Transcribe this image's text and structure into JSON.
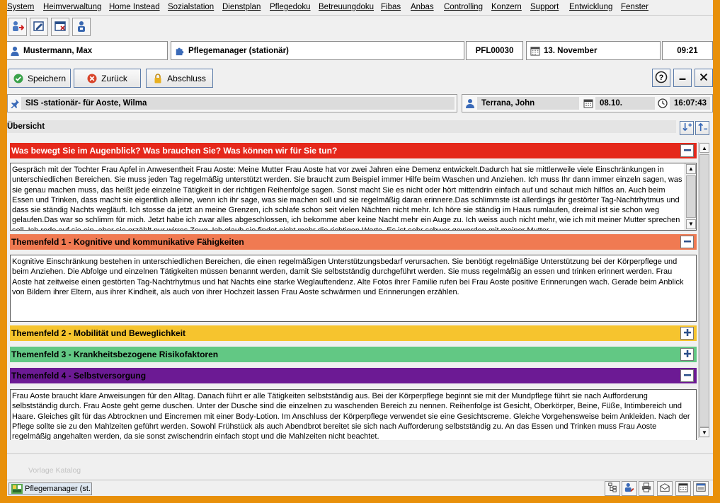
{
  "menu": [
    "System",
    "Heimverwaltung",
    "Home Instead",
    "Sozialstation",
    "Dienstplan",
    "Pflegedoku",
    "Betreuungdoku",
    "Fibas",
    "Anbas",
    "Controlling",
    "Konzern",
    "Support",
    "Entwicklung",
    "Fenster"
  ],
  "toolbar_icons": [
    "exit-icon",
    "edit-icon",
    "close-window-icon",
    "person-card-icon"
  ],
  "header": {
    "user": "Mustermann, Max",
    "module": "Pflegemanager (stationär)",
    "code": "PFL00030",
    "date": "13. November",
    "time": "09:21"
  },
  "actions": {
    "save": "Speichern",
    "back": "Zurück",
    "finish": "Abschluss"
  },
  "record": {
    "title": "SIS -stationär- für Aoste, Wilma",
    "author": "Terrana, John",
    "date": "08.10.",
    "time": "16:07:43"
  },
  "overview_label": "Übersicht",
  "sections": [
    {
      "title": "Was bewegt Sie im Augenblick? Was brauchen Sie? Was können wir für Sie tun?",
      "color": "#e5281b",
      "text_color": "#ffffff",
      "expanded": true,
      "text": "Gespräch mit der Tochter Frau Apfel in Anwesentheit Frau Aoste: Meine Mutter Frau Aoste hat vor zwei Jahren eine Demenz entwickelt.Dadurch hat sie mittlerweile viele Einschränkungen in unterschiedlichen Bereichen. Sie muss jeden Tag regelmäßig unterstützt werden. Sie braucht zum Beispiel immer Hilfe beim Waschen und Anziehen. Ich muss Ihr dann immer einzeln sagen, was sie genau machen muss, das heißt jede einzelne Tätigkeit in der richtigen Reihenfolge sagen. Sonst macht Sie es nicht oder hört mittendrin einfach auf und schaut mich hilflos an. Auch beim Essen und Trinken, dass macht sie eigentlich alleine, wenn ich ihr sage, was sie machen soll und sie regelmäßig daran erinnere.Das schlimmste ist allerdings ihr gestörter Tag-Nachtrhytmus und dass sie ständig Nachts wegläuft. Ich stosse da jetzt an meine Grenzen, ich schlafe schon seit vielen Nächten nicht mehr. Ich höre sie ständig im Haus rumlaufen, dreimal ist sie schon weg gelaufen.Das war so schlimm für mich. Jetzt habe ich zwar alles abgeschlossen, ich bekomme aber keine Nacht mehr ein Auge zu. Ich weiss auch nicht mehr, wie ich mit meiner Mutter sprechen soll. Ich rede auf sie ein, aber sie erzählt nur wirres Zeug. Ich glaub sie findet nicht mehr die richtigen Worte. Es ist sehr schwer geworden mit meiner Mutter."
    },
    {
      "title": "Themenfeld 1 - Kognitive und kommunikative Fähigkeiten",
      "color": "#f07a52",
      "text_color": "#000000",
      "expanded": true,
      "text": "Kognitive Einschränkung bestehen in unterschiedlichen Bereichen, die einen regelmäßigen Unterstützungsbedarf verursachen. Sie benötigt regelmäßige Unterstützung bei der Körperpflege und beim Anziehen. Die Abfolge und einzelnen Tätigkeiten müssen benannt werden, damit Sie selbstständig durchgeführt werden. Sie muss regelmäßig an essen und trinken erinnert werden. Frau Aoste hat zeitweise einen gestörten Tag-Nachtrhytmus und hat Nachts eine starke Weglauftendenz. Alte Fotos ihrer Familie rufen bei Frau Aoste positive Erinnerungen wach. Gerade beim Anblick von Bildern ihrer Eltern, aus ihrer Kindheit, als auch von ihrer Hochzeit lassen Frau Aoste schwärmen und Erinnerungen erzählen."
    },
    {
      "title": "Themenfeld 2 - Mobilität und Beweglichkeit",
      "color": "#f6c42e",
      "text_color": "#000000",
      "expanded": false
    },
    {
      "title": "Themenfeld 3 - Krankheitsbezogene Risikofaktoren",
      "color": "#62c884",
      "text_color": "#000000",
      "expanded": false
    },
    {
      "title": "Themenfeld 4 - Selbstversorgung",
      "color": "#6c1a94",
      "text_color": "#000000",
      "expanded": true,
      "text": "Frau Aoste braucht klare Anweisungen für den Alltag. Danach führt er alle Tätigkeiten selbstständig aus. Bei der Körperpflege beginnt sie mit der Mundpflege führt sie nach Aufforderung selbstständig durch. Frau Aoste geht gerne duschen. Unter der Dusche sind die einzelnen zu waschenden Bereich zu nennen. Reihenfolge ist Gesicht, Oberkörper, Beine, Füße, Intimbereich und Haare. Gleiches gilt für das Abtrocknen und Eincremen mit einer Body-Lotion. Im Anschluss der Körperpflege verwendet sie eine Gesichtscreme. Gleiche Vorgehensweise beim Ankleiden. Nach der Pflege sollte sie zu den Mahlzeiten geführt werden. Sowohl Frühstück als auch Abendbrot bereitet sie sich nach Aufforderung selbstständig zu. An das Essen und Trinken muss Frau Aoste regelmäßig angehalten werden, da sie sonst zwischendrin einfach stopt und die Mahlzeiten nicht beachtet."
    }
  ],
  "watermark": "Vorlage Katalog",
  "taskbar": {
    "item": "Pflegemanager (st..."
  },
  "status_icons": [
    "hierarchy-icon",
    "user-edit-icon",
    "printer-icon",
    "mail-icon",
    "calendar-icon",
    "window-icon"
  ]
}
